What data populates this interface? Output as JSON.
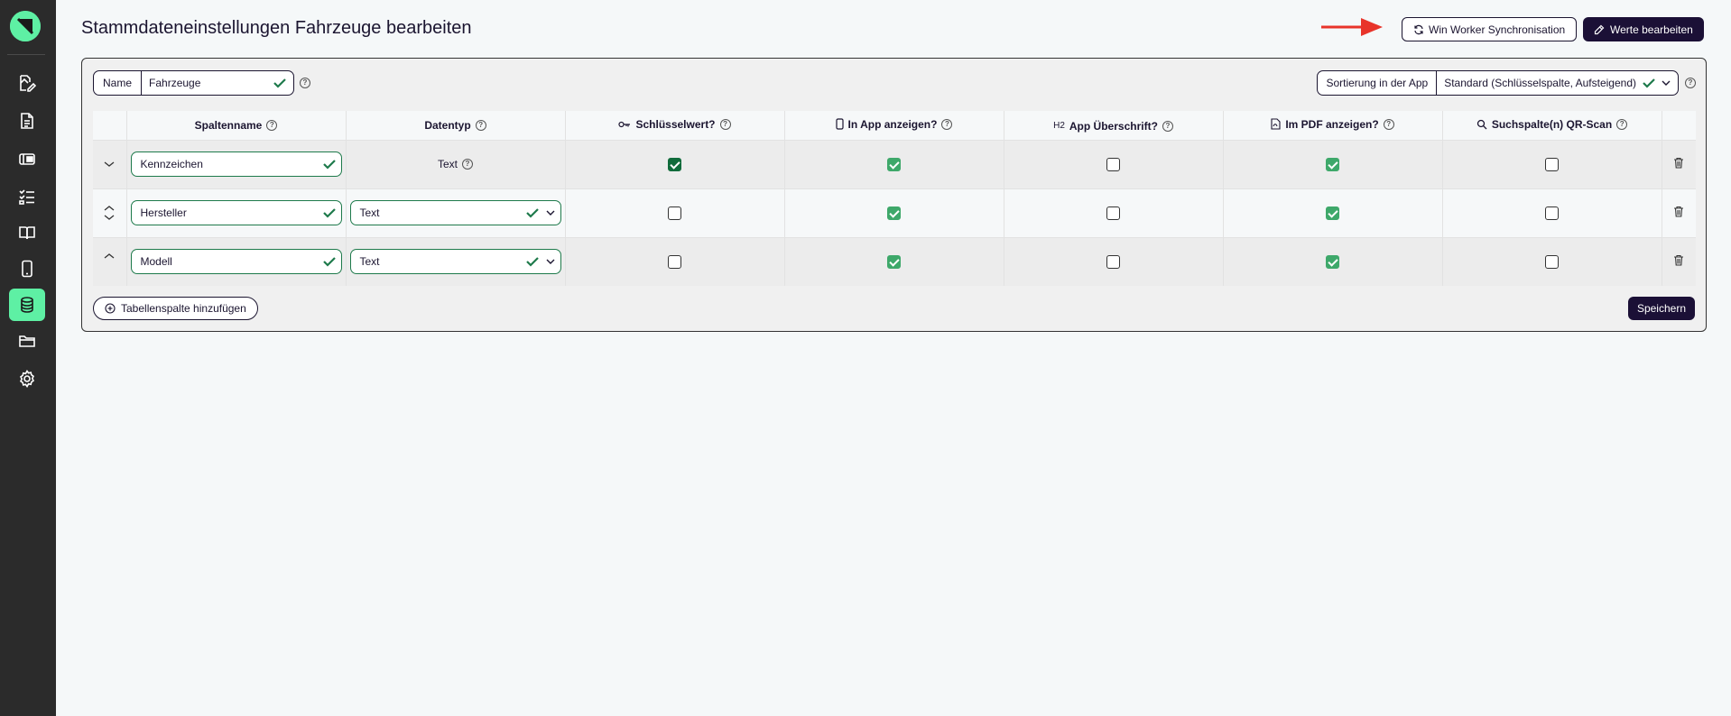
{
  "page": {
    "title": "Stammdateneinstellungen Fahrzeuge bearbeiten"
  },
  "header": {
    "sync_label": "Win Worker Synchronisation",
    "edit_values_label": "Werte bearbeiten"
  },
  "name_field": {
    "label": "Name",
    "value": "Fahrzeuge"
  },
  "sort_field": {
    "label": "Sortierung in der App",
    "value": "Standard (Schlüsselspalte, Aufsteigend)"
  },
  "table": {
    "columns": [
      "Spaltenname",
      "Datentyp",
      "Schlüsselwert?",
      "In App anzeigen?",
      "App Überschrift?",
      "Im PDF anzeigen?",
      "Suchspalte(n) QR-Scan"
    ],
    "heading_icon_text": "H2",
    "rows": [
      {
        "name": "Kennzeichen",
        "datatype": "Text",
        "datatype_editable": false,
        "key": true,
        "in_app": true,
        "app_heading": false,
        "in_pdf": true,
        "qr_search": false
      },
      {
        "name": "Hersteller",
        "datatype": "Text",
        "datatype_editable": true,
        "key": false,
        "in_app": true,
        "app_heading": false,
        "in_pdf": true,
        "qr_search": false
      },
      {
        "name": "Modell",
        "datatype": "Text",
        "datatype_editable": true,
        "key": false,
        "in_app": true,
        "app_heading": false,
        "in_pdf": true,
        "qr_search": false
      }
    ]
  },
  "footer": {
    "add_column_label": "Tabellenspalte hinzufügen",
    "save_label": "Speichern"
  },
  "colors": {
    "sidebar_bg": "#2b2b2b",
    "accent": "#5ef0a4",
    "primary": "#1b1036",
    "check_green": "#3ea86a",
    "field_border": "#1e7a4b",
    "arrow": "#e8342a"
  },
  "sidebar": {
    "items": [
      {
        "icon": "edit-document-icon",
        "active": false
      },
      {
        "icon": "document-list-icon",
        "active": false
      },
      {
        "icon": "inbox-icon",
        "active": false
      },
      {
        "icon": "checklist-icon",
        "active": false
      },
      {
        "icon": "book-icon",
        "active": false
      },
      {
        "icon": "smartphone-icon",
        "active": false
      },
      {
        "icon": "database-icon",
        "active": true
      },
      {
        "icon": "folder-icon",
        "active": false
      },
      {
        "icon": "gear-icon",
        "active": false
      }
    ]
  }
}
